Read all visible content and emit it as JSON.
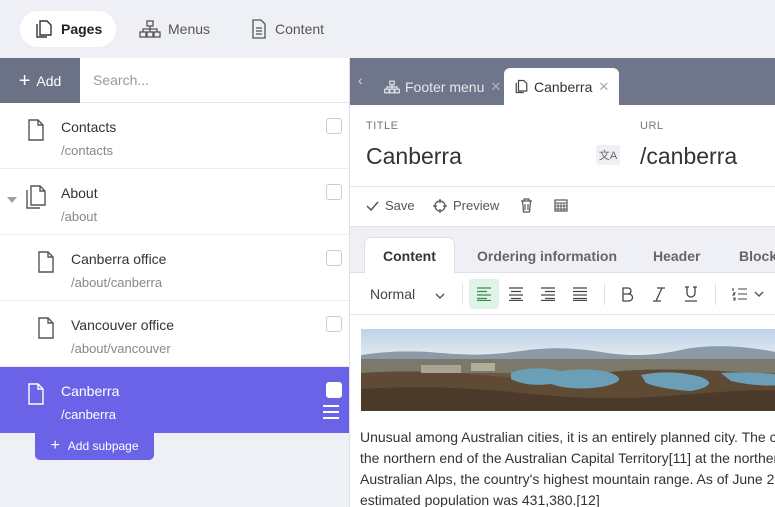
{
  "topnav": {
    "tabs": [
      {
        "label": "Pages",
        "icon": "pages-icon",
        "active": true
      },
      {
        "label": "Menus",
        "icon": "sitemap-icon",
        "active": false
      },
      {
        "label": "Content",
        "icon": "document-icon",
        "active": false
      }
    ]
  },
  "toolbar": {
    "add_label": "Add",
    "search_placeholder": "Search..."
  },
  "tree": [
    {
      "title": "Contacts",
      "path": "/contacts",
      "level": 0,
      "icon": "page-icon"
    },
    {
      "title": "About",
      "path": "/about",
      "level": 0,
      "icon": "pages-icon",
      "expanded": true
    },
    {
      "title": "Canberra office",
      "path": "/about/canberra",
      "level": 1,
      "icon": "page-icon"
    },
    {
      "title": "Vancouver office",
      "path": "/about/vancouver",
      "level": 1,
      "icon": "page-icon"
    },
    {
      "title": "Canberra",
      "path": "/canberra",
      "level": 0,
      "icon": "page-icon",
      "selected": true
    }
  ],
  "add_subpage_label": "Add subpage",
  "doc_tabs": [
    {
      "label": "Footer menu",
      "icon": "sitemap-icon",
      "active": false
    },
    {
      "label": "Canberra",
      "icon": "pages-icon",
      "active": true
    }
  ],
  "fields": {
    "title_label": "TITLE",
    "title_value": "Canberra",
    "url_label": "URL",
    "url_value": "/canberra"
  },
  "actions": {
    "save": "Save",
    "preview": "Preview"
  },
  "subtabs": [
    "Content",
    "Ordering information",
    "Header",
    "Blocks"
  ],
  "editor": {
    "style_value": "Normal"
  },
  "content": {
    "lines": [
      "Unusual among Australian cities, it is an entirely planned city. The c",
      "the northern end of the Australian Capital Territory[11] at the norther",
      "Australian Alps, the country's highest mountain range. As of June 2",
      "estimated population was 431,380.[12]"
    ]
  },
  "colors": {
    "accent": "#6a63e8",
    "tabbar": "#6f768b",
    "add_button": "#6b7286",
    "active_align": "#dff3e6"
  }
}
